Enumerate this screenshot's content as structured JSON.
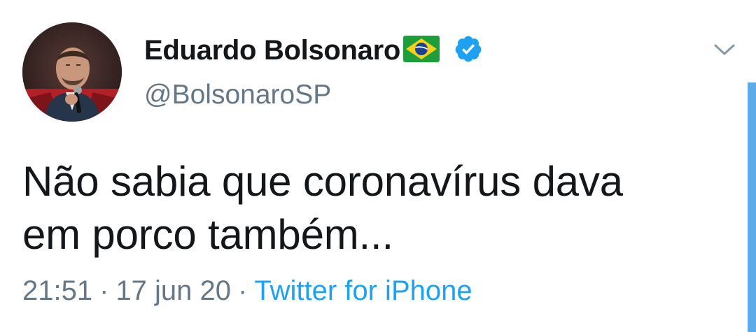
{
  "tweet": {
    "author": {
      "display_name": "Eduardo Bolsonaro",
      "flag_icon": "brazil-flag-emoji",
      "verified_icon": "verified-badge-icon",
      "handle": "@BolsonaroSP"
    },
    "text_line_1": "Não sabia que coronavírus dava",
    "text_line_2": "em porco também...",
    "time": "21:51",
    "separator": "·",
    "date": "17 jun 20",
    "source": "Twitter for iPhone"
  },
  "colors": {
    "text": "#14171a",
    "secondary": "#657786",
    "link": "#1da1f2",
    "verified": "#1da1f2",
    "scrollbar": "#5dabe9"
  }
}
